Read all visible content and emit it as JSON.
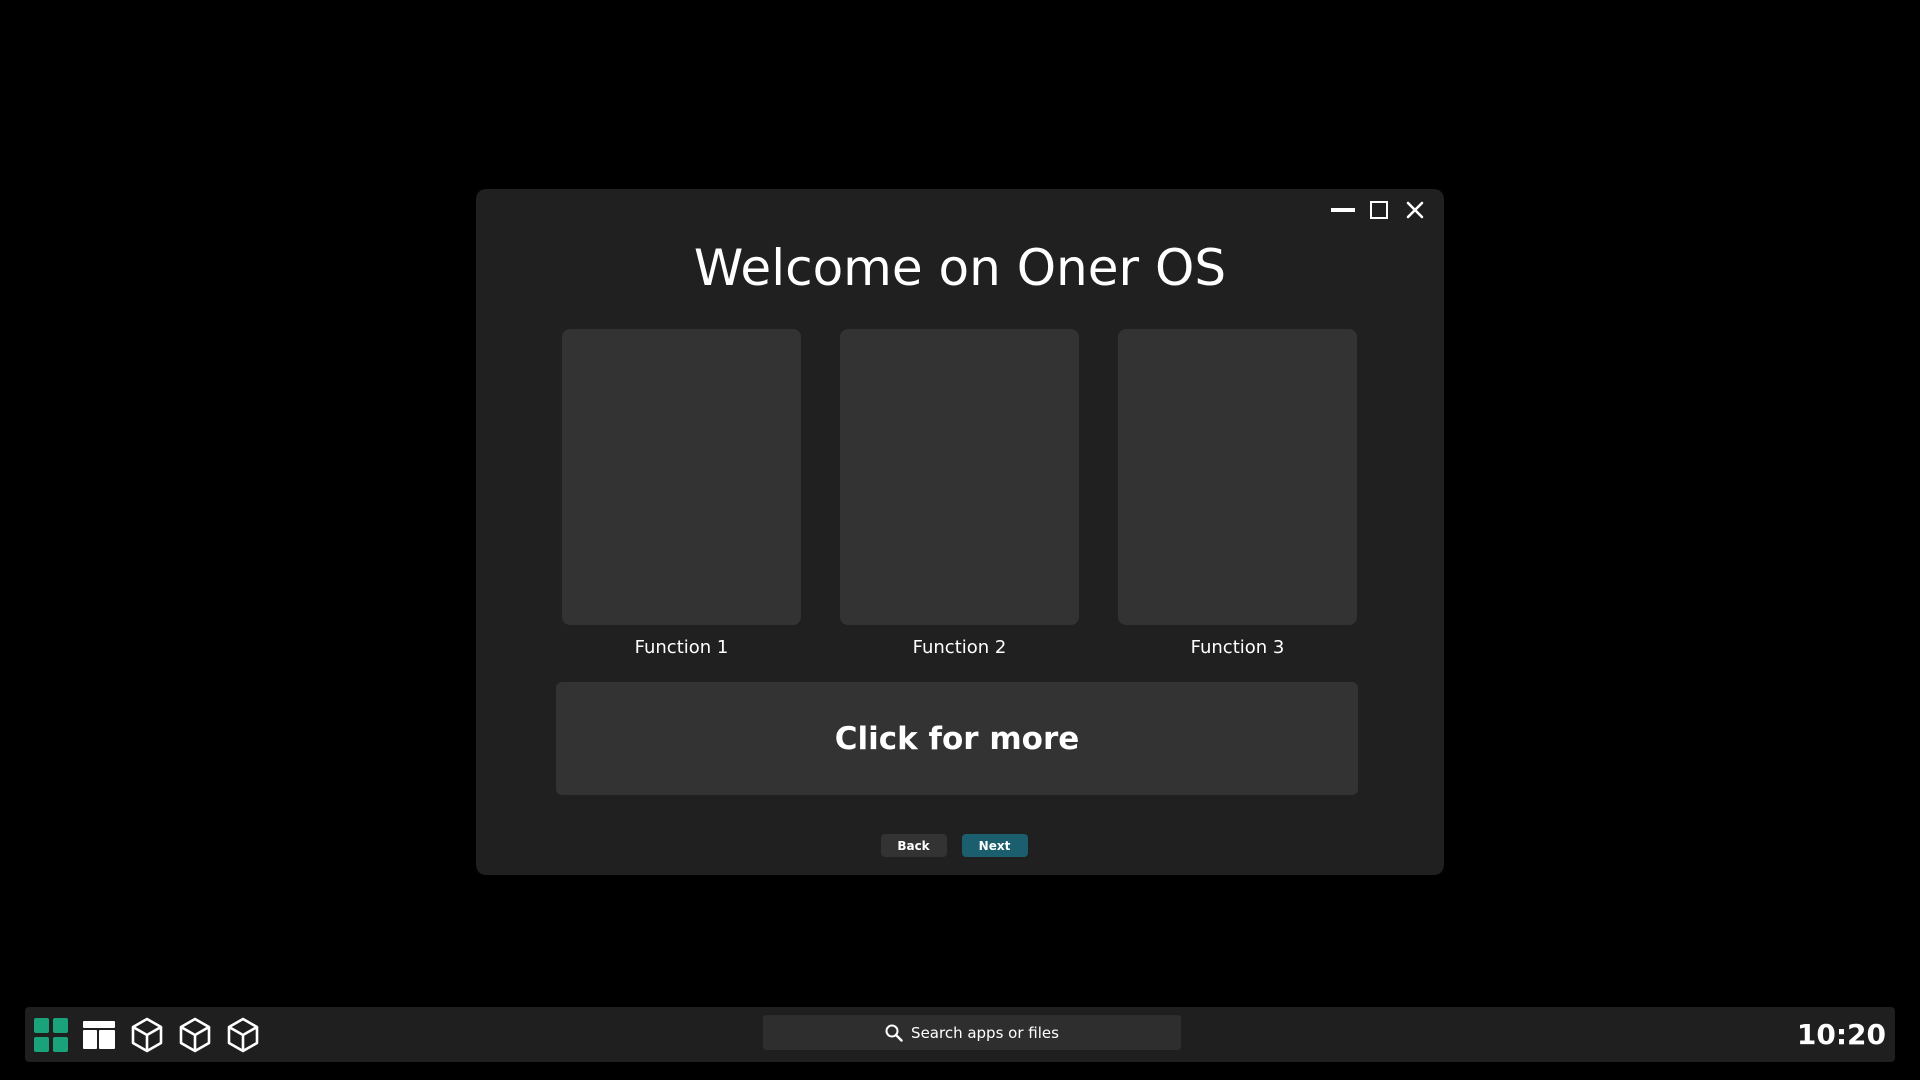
{
  "colors": {
    "desktop_bg": "#000000",
    "window_bg": "#202020",
    "card_bg": "#333333",
    "accent": "#1b5e6e",
    "start_icon": "#1aa37a"
  },
  "window": {
    "title": "Welcome on Oner OS",
    "controls": {
      "minimize": "minimize-icon",
      "maximize": "maximize-icon",
      "close": "close-icon"
    },
    "cards": [
      {
        "label": "Function 1"
      },
      {
        "label": "Function 2"
      },
      {
        "label": "Function 3"
      }
    ],
    "more_label": "Click for more",
    "back_label": "Back",
    "next_label": "Next"
  },
  "taskbar": {
    "apps": [
      {
        "icon": "start-grid-icon"
      },
      {
        "icon": "window-layout-icon"
      },
      {
        "icon": "cube-icon"
      },
      {
        "icon": "cube-icon"
      },
      {
        "icon": "cube-icon"
      }
    ],
    "search_placeholder": "Search apps or files",
    "clock": "10:20"
  }
}
